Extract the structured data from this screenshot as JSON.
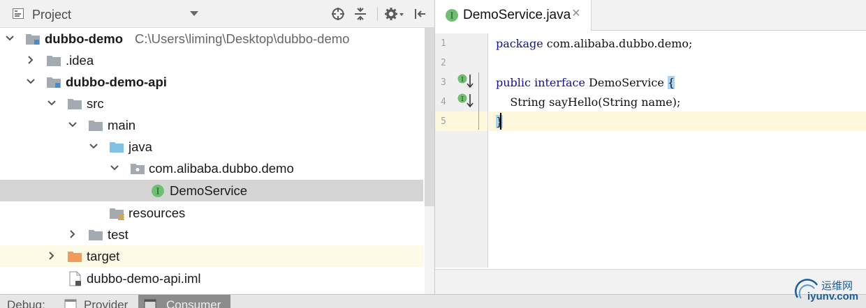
{
  "project_panel": {
    "title": "Project",
    "tree": [
      {
        "label": "dubbo-demo",
        "path": "C:\\Users\\liming\\Desktop\\dubbo-demo"
      },
      {
        "label": ".idea"
      },
      {
        "label": "dubbo-demo-api"
      },
      {
        "label": "src"
      },
      {
        "label": "main"
      },
      {
        "label": "java"
      },
      {
        "label": "com.alibaba.dubbo.demo"
      },
      {
        "label": "DemoService"
      },
      {
        "label": "resources"
      },
      {
        "label": "test"
      },
      {
        "label": "target"
      },
      {
        "label": "dubbo-demo-api.iml"
      }
    ]
  },
  "editor": {
    "tab": {
      "label": "DemoService.java",
      "close": "×",
      "icon_letter": "I"
    },
    "line_numbers": [
      "1",
      "2",
      "3",
      "4",
      "5"
    ],
    "code": {
      "l1_kw": "package",
      "l1_rest": " com.alibaba.dubbo.demo;",
      "l3_kw": "public interface",
      "l3_rest": " DemoService ",
      "l3_brace": "{",
      "l4": "    String sayHello(String name);",
      "l5": "}"
    }
  },
  "bottom_bar": {
    "debug": "Debug:",
    "tabs": [
      "Provider",
      "Consumer"
    ]
  },
  "watermark": {
    "cn": "运维网",
    "url": "iyunv.com"
  },
  "colors": {
    "interface_icon": "#6fbf73",
    "folder": "#a3aab2",
    "source_folder": "#7ec3e6",
    "excluded_folder": "#f09d5b",
    "keyword": "#101090",
    "selection_row": "#d5d5d5",
    "current_line": "#fdf7dc"
  }
}
